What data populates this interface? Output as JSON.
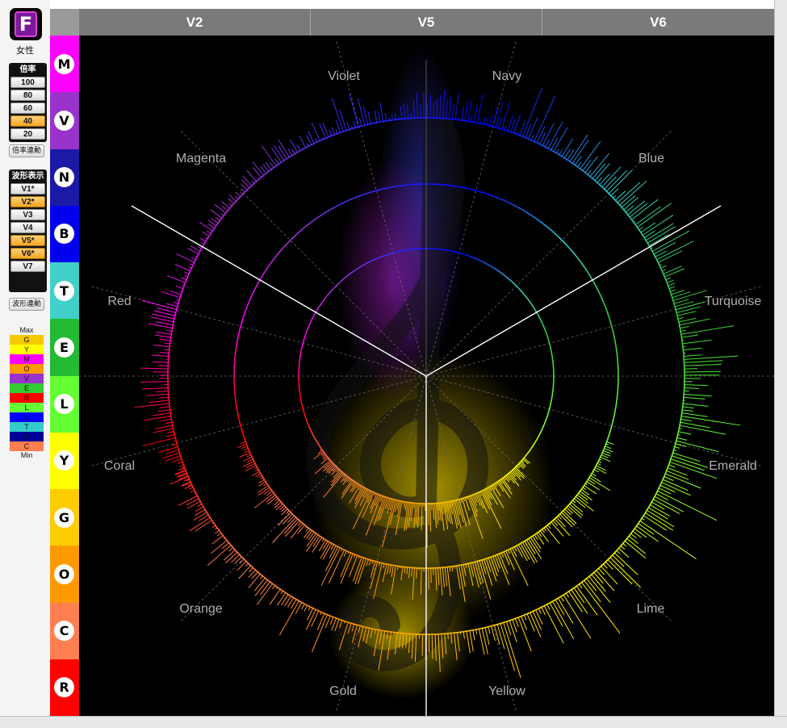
{
  "logo": {
    "letter": "F",
    "caption": "女性"
  },
  "magnification": {
    "title": "倍率",
    "options": [
      {
        "label": "100",
        "active": false
      },
      {
        "label": "80",
        "active": false
      },
      {
        "label": "60",
        "active": false
      },
      {
        "label": "40",
        "active": true
      },
      {
        "label": "20",
        "active": false
      }
    ],
    "link_label": "倍率連動"
  },
  "waveform": {
    "title": "波形表示",
    "options": [
      {
        "label": "V1*",
        "active": false
      },
      {
        "label": "V2*",
        "active": true
      },
      {
        "label": "V3",
        "active": false
      },
      {
        "label": "V4",
        "active": false
      },
      {
        "label": "V5*",
        "active": true
      },
      {
        "label": "V6*",
        "active": true
      },
      {
        "label": "V7",
        "active": false
      }
    ],
    "link_label": "波形連動"
  },
  "legend": {
    "max_label": "Max",
    "min_label": "Min",
    "items": [
      {
        "letter": "G",
        "color": "#f5c800"
      },
      {
        "letter": "Y",
        "color": "#ffff00"
      },
      {
        "letter": "M",
        "color": "#ff00ff"
      },
      {
        "letter": "O",
        "color": "#ff9900"
      },
      {
        "letter": "V",
        "color": "#9933cc"
      },
      {
        "letter": "E",
        "color": "#33cc33"
      },
      {
        "letter": "R",
        "color": "#ff0000"
      },
      {
        "letter": "L",
        "color": "#66ff33"
      },
      {
        "letter": "B",
        "color": "#0000ff"
      },
      {
        "letter": "T",
        "color": "#33cccc"
      },
      {
        "letter": "N",
        "color": "#000099"
      },
      {
        "letter": "C",
        "color": "#ff7f50"
      }
    ]
  },
  "strip": [
    {
      "letter": "M",
      "color": "#ff00ff"
    },
    {
      "letter": "V",
      "color": "#9933cc"
    },
    {
      "letter": "N",
      "color": "#1a1aa6"
    },
    {
      "letter": "B",
      "color": "#0000ee"
    },
    {
      "letter": "T",
      "color": "#40d0c8"
    },
    {
      "letter": "E",
      "color": "#22bb33"
    },
    {
      "letter": "L",
      "color": "#66ff33"
    },
    {
      "letter": "Y",
      "color": "#ffff00"
    },
    {
      "letter": "G",
      "color": "#ffcc00"
    },
    {
      "letter": "O",
      "color": "#ff9900"
    },
    {
      "letter": "C",
      "color": "#ff7f50"
    },
    {
      "letter": "R",
      "color": "#ff0000"
    }
  ],
  "columns": [
    "V2",
    "V5",
    "V6"
  ],
  "chart_data": {
    "type": "radial",
    "sectors": [
      {
        "name": "Navy",
        "color": "#2a2aff"
      },
      {
        "name": "Blue",
        "color": "#0000ff"
      },
      {
        "name": "Turquoise",
        "color": "#33cccc"
      },
      {
        "name": "Emerald",
        "color": "#33cc33"
      },
      {
        "name": "Lime",
        "color": "#66ff33"
      },
      {
        "name": "Yellow",
        "color": "#ffff00"
      },
      {
        "name": "Gold",
        "color": "#ffcc00"
      },
      {
        "name": "Orange",
        "color": "#ff9900"
      },
      {
        "name": "Coral",
        "color": "#ff7f50"
      },
      {
        "name": "Red",
        "color": "#ff0000"
      },
      {
        "name": "Magenta",
        "color": "#ff00ff"
      },
      {
        "name": "Violet",
        "color": "#9933cc"
      }
    ],
    "rings": [
      "V2",
      "V5",
      "V6"
    ]
  }
}
